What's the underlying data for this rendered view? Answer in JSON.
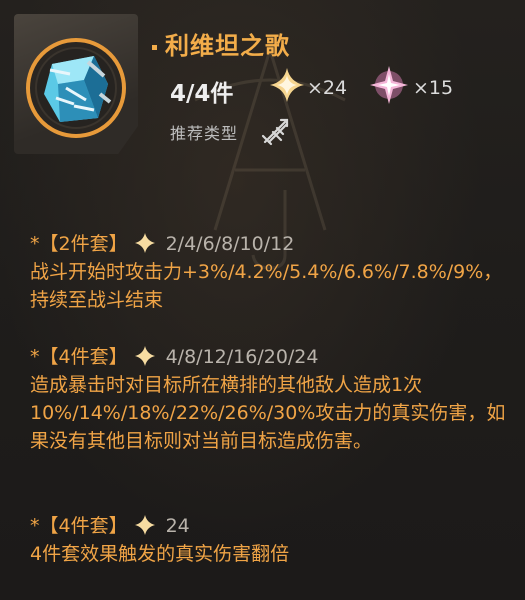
{
  "set": {
    "name": "利维坦之歌",
    "count": "4/4件",
    "materials": [
      {
        "icon": "gold-sparkle-icon",
        "qty": "×24"
      },
      {
        "icon": "pink-star-icon",
        "qty": "×15"
      }
    ],
    "recommend_label": "推荐类型",
    "recommend_icon": "crossed-swords-icon"
  },
  "effects": [
    {
      "tag": "*【2件套】",
      "levels": "2/4/6/8/10/12",
      "text": "战斗开始时攻击力+3%/4.2%/5.4%/6.6%/7.8%/9%，持续至战斗结束"
    },
    {
      "tag": "*【4件套】",
      "levels": "4/8/12/16/20/24",
      "text": "造成暴击时对目标所在横排的其他敌人造成1次10%/14%/18%/22%/26%/30%攻击力的真实伤害，如果没有其他目标则对当前目标造成伤害。"
    },
    {
      "tag": "*【4件套】",
      "levels": "24",
      "text": "4件套效果触发的真实伤害翻倍"
    }
  ],
  "colors": {
    "accent": "#f3ad4a",
    "text_orange": "#f0a446",
    "grey": "#b9b3ab",
    "background": "#1e1c1a"
  }
}
